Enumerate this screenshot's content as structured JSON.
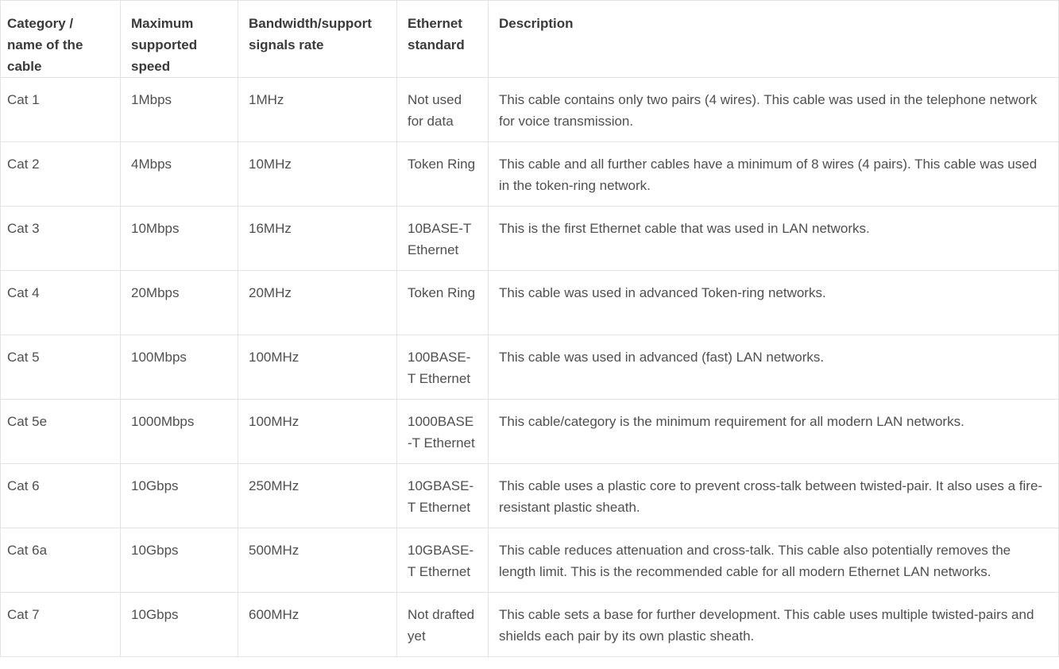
{
  "table": {
    "headers": [
      "Category / name of the cable",
      "Maximum supported speed",
      "Bandwidth/support signals rate",
      "Ethernet standard",
      "Description"
    ],
    "rows": [
      [
        "Cat 1",
        "1Mbps",
        "1MHz",
        "Not used for data",
        "This cable contains only two pairs (4 wires). This cable was used in the telephone network for voice transmission."
      ],
      [
        "Cat 2",
        "4Mbps",
        "10MHz",
        "Token Ring",
        "This cable and all further cables have a minimum of 8 wires (4 pairs). This cable was used in the token-ring network."
      ],
      [
        "Cat 3",
        "10Mbps",
        "16MHz",
        "10BASE-T Ethernet",
        "This is the first Ethernet cable that was used in LAN networks."
      ],
      [
        "Cat 4",
        "20Mbps",
        "20MHz",
        "Token Ring",
        "This cable was used in advanced Token-ring networks."
      ],
      [
        "Cat 5",
        "100Mbps",
        "100MHz",
        "100BASE-T Ethernet",
        "This cable was used in advanced (fast) LAN networks."
      ],
      [
        "Cat 5e",
        "1000Mbps",
        "100MHz",
        "1000BASE-T Ethernet",
        "This cable/category is the minimum requirement for all modern LAN networks."
      ],
      [
        "Cat 6",
        "10Gbps",
        "250MHz",
        "10GBASE-T Ethernet",
        "This cable uses a plastic core to prevent cross-talk between twisted-pair. It also uses a fire-resistant plastic sheath."
      ],
      [
        "Cat 6a",
        "10Gbps",
        "500MHz",
        "10GBASE-T Ethernet",
        "This cable reduces attenuation and cross-talk. This cable also potentially removes the length limit. This is the recommended cable for all modern Ethernet LAN networks."
      ],
      [
        "Cat 7",
        "10Gbps",
        "600MHz",
        "Not drafted yet",
        "This cable sets a base for further development. This cable uses multiple twisted-pairs and shields each pair by its own plastic sheath."
      ]
    ]
  }
}
